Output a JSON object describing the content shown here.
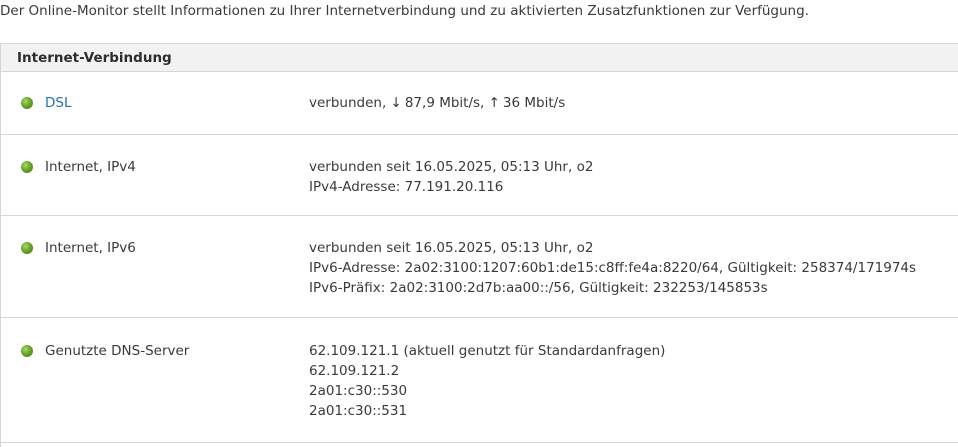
{
  "intro_text": "Der Online-Monitor stellt Informationen zu Ihrer Internetverbindung und zu aktivierten Zusatzfunktionen zur Verfügung.",
  "panel": {
    "title": "Internet-Verbindung"
  },
  "colors": {
    "status_led": "#6aa52a",
    "link": "#2870b0"
  },
  "rows": [
    {
      "label": "DSL",
      "status": "connected",
      "details": {
        "prefix": "verbunden,",
        "down_arrow": "↓",
        "down_rate": "87,9 Mbit/s,",
        "up_arrow": "↑",
        "up_rate": "36 Mbit/s"
      }
    },
    {
      "label": "Internet, IPv4",
      "status": "connected",
      "lines": [
        "verbunden seit 16.05.2025, 05:13 Uhr, o2",
        "IPv4-Adresse: 77.191.20.116"
      ]
    },
    {
      "label": "Internet, IPv6",
      "status": "connected",
      "lines": [
        "verbunden seit 16.05.2025, 05:13 Uhr, o2",
        "IPv6-Adresse: 2a02:3100:1207:60b1:de15:c8ff:fe4a:8220/64, Gültigkeit: 258374/171974s",
        "IPv6-Präfix: 2a02:3100:2d7b:aa00::/56, Gültigkeit: 232253/145853s"
      ]
    },
    {
      "label": "Genutzte DNS-Server",
      "status": "connected",
      "lines": [
        "62.109.121.1 (aktuell genutzt für Standardanfragen)",
        "62.109.121.2",
        "2a01:c30::530",
        "2a01:c30::531"
      ]
    }
  ]
}
